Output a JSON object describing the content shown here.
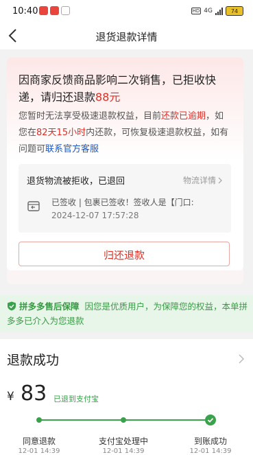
{
  "status_bar": {
    "time": "10:40",
    "network": "4G",
    "battery": "74"
  },
  "header": {
    "title": "退货退款详情"
  },
  "notice": {
    "headline_prefix": "因商家反馈商品影响二次销售，已拒收快递，请归还退款",
    "headline_amount": "88元",
    "desc_part1": "您暂时无法享受极速退款权益，目前",
    "desc_overdue": "还款已逾期",
    "desc_part2": "，如您在",
    "desc_deadline": "82天15小时",
    "desc_part3": "内还款，可恢复极速退款权益，如有问题可",
    "desc_link": "联系官方客服"
  },
  "logistics": {
    "title": "退货物流被拒收，已退回",
    "detail_link": "物流详情",
    "message": "已签收 | 包裹已签收！签收人是【门口:",
    "timestamp": "2024-12-07 17:57:28"
  },
  "return_button": {
    "label": "归还退款"
  },
  "banner": {
    "brand": "拼多多售后保障",
    "text": "因您是优质用户，为保障您的权益，本单拼多多已介入为您退款"
  },
  "refund": {
    "title": "退款成功",
    "currency": "¥",
    "amount": "83",
    "note": "已退到支付宝",
    "steps": [
      {
        "label": "同意退款",
        "time": "12-01 14:39"
      },
      {
        "label": "支付宝处理中",
        "time": "12-01 14:39"
      },
      {
        "label": "到账成功",
        "time": "12-01 14:39"
      }
    ]
  },
  "colors": {
    "accent_red": "#e02e24",
    "accent_green": "#3aa24b",
    "link_blue": "#1a58c8"
  }
}
